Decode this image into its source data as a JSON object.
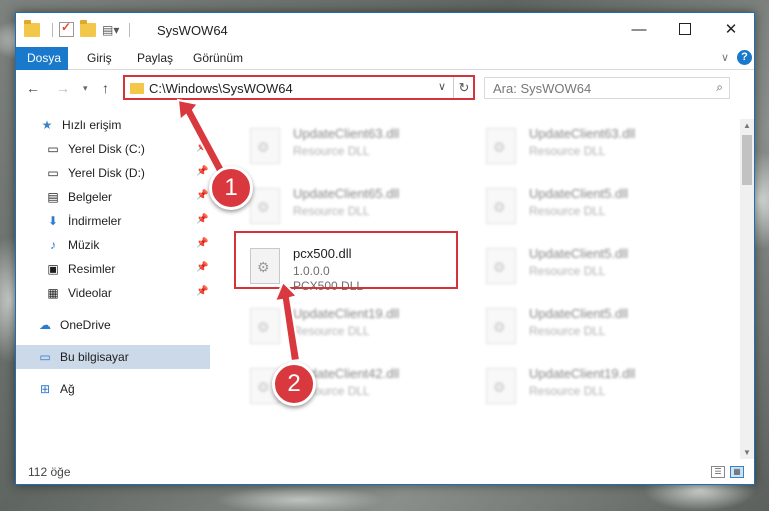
{
  "window": {
    "title": "SysWOW64"
  },
  "ribbon": {
    "tabs": [
      "Dosya",
      "Giriş",
      "Paylaş",
      "Görünüm"
    ]
  },
  "nav": {
    "address_path": "C:\\Windows\\SysWOW64",
    "search_placeholder": "Ara: SysWOW64"
  },
  "sidebar": {
    "quick_access": "Hızlı erişim",
    "items": [
      {
        "label": "Yerel Disk (C:)",
        "icon": "drive-icon"
      },
      {
        "label": "Yerel Disk (D:)",
        "icon": "drive-icon"
      },
      {
        "label": "Belgeler",
        "icon": "documents-icon"
      },
      {
        "label": "İndirmeler",
        "icon": "download-icon"
      },
      {
        "label": "Müzik",
        "icon": "music-icon"
      },
      {
        "label": "Resimler",
        "icon": "pictures-icon"
      },
      {
        "label": "Videolar",
        "icon": "videos-icon"
      }
    ],
    "onedrive": "OneDrive",
    "this_pc": "Bu bilgisayar",
    "network": "Ağ"
  },
  "files": [
    {
      "name": "UpdateClient63.dll",
      "type": "Resource DLL"
    },
    {
      "name": "UpdateClient63.dll",
      "type": "Resource DLL"
    },
    {
      "name": "UpdateClient65.dll",
      "type": "Resource DLL"
    },
    {
      "name": "UpdateClient5.dll",
      "type": "Resource DLL"
    },
    {
      "name": "pcx500.dll",
      "version": "1.0.0.0",
      "type": "PCX500 DLL"
    },
    {
      "name": "UpdateClient5.dll",
      "type": "Resource DLL"
    },
    {
      "name": "UpdateClient19.dll",
      "type": "Resource DLL"
    },
    {
      "name": "UpdateClient5.dll",
      "type": "Resource DLL"
    },
    {
      "name": "UpdateClient42.dll",
      "type": "Resource DLL"
    },
    {
      "name": "UpdateClient19.dll",
      "type": "Resource DLL"
    }
  ],
  "status": {
    "count": "112 öğe"
  },
  "annotations": {
    "step1": "1",
    "step2": "2"
  },
  "colors": {
    "accent": "#1979ca",
    "highlight": "#d4333a"
  }
}
